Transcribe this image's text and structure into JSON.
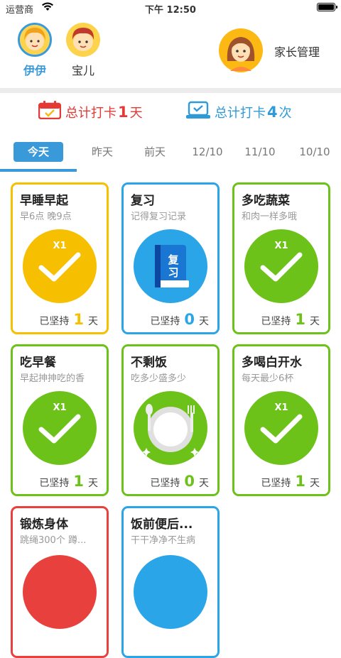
{
  "status_bar": {
    "carrier": "运营商",
    "time": "下午 12:50"
  },
  "kids": [
    {
      "name": "伊伊",
      "active": true
    },
    {
      "name": "宝儿",
      "active": false
    }
  ],
  "parent": {
    "label": "家长管理"
  },
  "totals": {
    "days_prefix": "总计打卡",
    "days_value": "1",
    "days_unit": "天",
    "times_prefix": "总计打卡",
    "times_value": "4",
    "times_unit": "次"
  },
  "tabs": [
    "今天",
    "昨天",
    "前天",
    "12/10",
    "11/10",
    "10/10"
  ],
  "cards": [
    {
      "title": "早睡早起",
      "subtitle": "早6点 晚9点",
      "count_prefix": "已坚持",
      "count": "1",
      "count_unit": "天",
      "badge": "X1",
      "color": "#f6c000",
      "icon": "check-icon"
    },
    {
      "title": "复习",
      "subtitle": "记得复习记录",
      "count_prefix": "已坚持",
      "count": "0",
      "count_unit": "天",
      "badge": "",
      "color": "#2aa6e8",
      "icon": "book-icon",
      "book_text": "复\n习"
    },
    {
      "title": "多吃蔬菜",
      "subtitle": "和肉一样多哦",
      "count_prefix": "已坚持",
      "count": "1",
      "count_unit": "天",
      "badge": "X1",
      "color": "#6cc219",
      "icon": "check-icon"
    },
    {
      "title": "吃早餐",
      "subtitle": "早起抻抻吃的香",
      "count_prefix": "已坚持",
      "count": "1",
      "count_unit": "天",
      "badge": "X1",
      "color": "#6cc219",
      "icon": "check-icon"
    },
    {
      "title": "不剩饭",
      "subtitle": "吃多少盛多少",
      "count_prefix": "已坚持",
      "count": "0",
      "count_unit": "天",
      "badge": "",
      "color": "#6cc219",
      "icon": "plate-icon"
    },
    {
      "title": "多喝白开水",
      "subtitle": "每天最少6杯",
      "count_prefix": "已坚持",
      "count": "1",
      "count_unit": "天",
      "badge": "X1",
      "color": "#6cc219",
      "icon": "check-icon"
    },
    {
      "title": "锻炼身体",
      "subtitle": "跳绳300个 蹲...",
      "color": "#e8413d"
    },
    {
      "title": "饭前便后...",
      "subtitle": "干干净净不生病",
      "color": "#2aa6e8"
    }
  ]
}
